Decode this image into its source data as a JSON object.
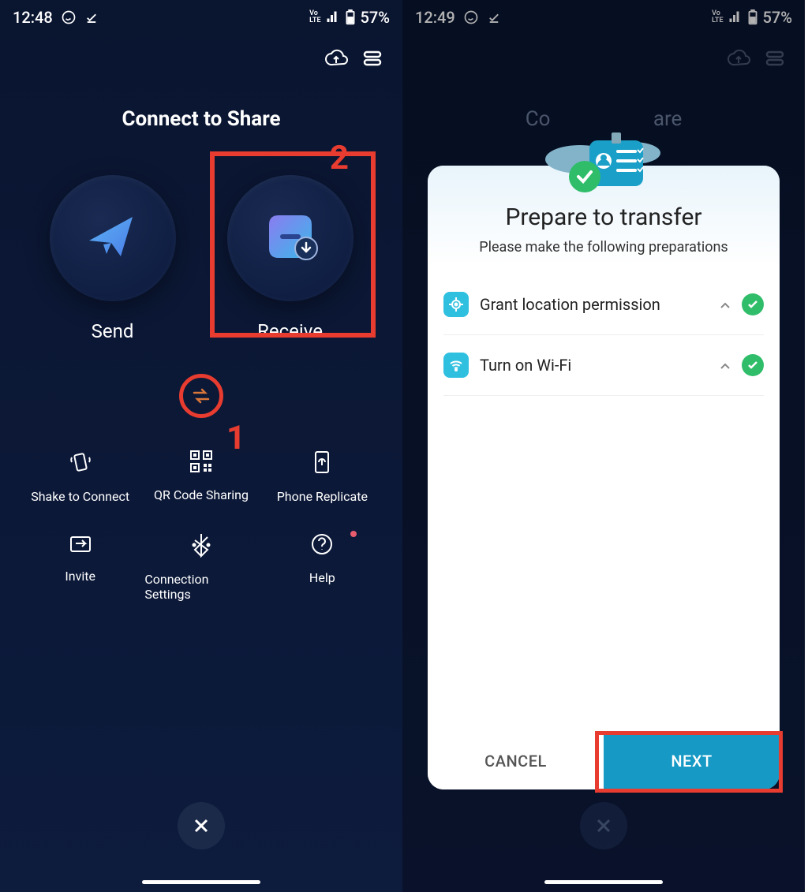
{
  "left": {
    "status": {
      "time": "12:48",
      "battery": "57%",
      "volte": "Vo LTE"
    },
    "title": "Connect to Share",
    "send_label": "Send",
    "receive_label": "Receive",
    "annotations": {
      "one": "1",
      "two": "2"
    },
    "grid": {
      "shake": "Shake to Connect",
      "qr": "QR Code Sharing",
      "replicate": "Phone Replicate",
      "invite": "Invite",
      "settings": "Connection Settings",
      "help": "Help"
    }
  },
  "right": {
    "status": {
      "time": "12:49",
      "battery": "57%",
      "volte": "Vo LTE"
    },
    "bg_title": "Connect to Share",
    "dialog": {
      "title": "Prepare to transfer",
      "subtitle": "Please make the following preparations",
      "items": {
        "location": "Grant location permission",
        "wifi": "Turn on Wi-Fi"
      },
      "cancel": "CANCEL",
      "next": "NEXT"
    }
  }
}
